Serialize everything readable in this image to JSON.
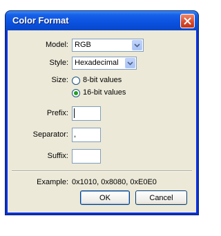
{
  "window": {
    "title": "Color Format"
  },
  "model": {
    "label": "Model:",
    "value": "RGB"
  },
  "style": {
    "label": "Style:",
    "value": "Hexadecimal"
  },
  "size": {
    "label": "Size:",
    "options": [
      {
        "label": "8-bit values",
        "selected": false
      },
      {
        "label": "16-bit values",
        "selected": true
      }
    ]
  },
  "prefix": {
    "label": "Prefix:",
    "value": ""
  },
  "separator": {
    "label": "Separator:",
    "value": ","
  },
  "suffix": {
    "label": "Suffix:",
    "value": ""
  },
  "example": {
    "label": "Example:",
    "value": "0x1010, 0x8080, 0xE0E0"
  },
  "buttons": {
    "ok": "OK",
    "cancel": "Cancel"
  }
}
